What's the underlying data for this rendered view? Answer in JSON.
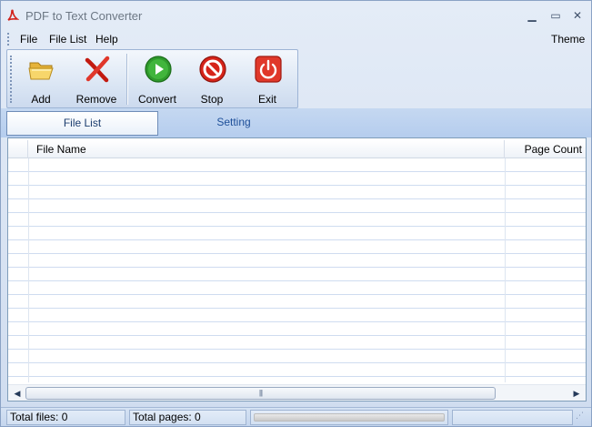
{
  "window": {
    "title": "PDF to Text Converter",
    "icon": "pdf-icon",
    "controls": {
      "minimize": "▁",
      "maximize": "▭",
      "close": "✕"
    }
  },
  "menu": {
    "file": "File",
    "file_list": "File List",
    "help": "Help",
    "theme": "Theme"
  },
  "toolbar": {
    "add": {
      "label": "Add",
      "icon": "folder-open-icon"
    },
    "remove": {
      "label": "Remove",
      "icon": "red-x-icon"
    },
    "convert": {
      "label": "Convert",
      "icon": "play-icon"
    },
    "stop": {
      "label": "Stop",
      "icon": "stop-icon"
    },
    "exit": {
      "label": "Exit",
      "icon": "power-icon"
    }
  },
  "tabs": {
    "file_list": "File List",
    "setting": "Setting",
    "active": "File List"
  },
  "file_table": {
    "columns": [
      "",
      "File Name",
      "Page Count"
    ],
    "rows": []
  },
  "scrollbar": {
    "thumb_grip": "|||"
  },
  "status": {
    "total_files": "Total files: 0",
    "total_pages": "Total pages: 0",
    "progress": 0
  },
  "colors": {
    "accent": "#1e4f99",
    "grid_line": "#cfdcf0",
    "panel_bg": "#ffffff"
  }
}
